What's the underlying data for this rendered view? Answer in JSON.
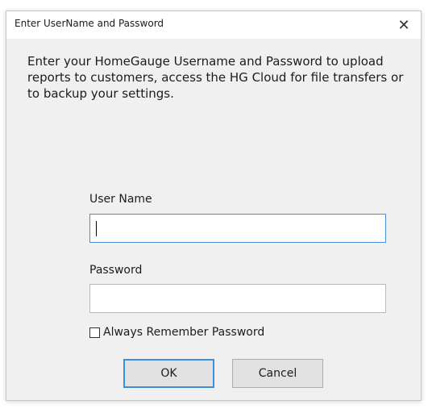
{
  "dialog": {
    "title": "Enter UserName and Password",
    "close_glyph": "✕",
    "close_icon": "close-icon",
    "intro": "Enter your HomeGauge Username and Password to upload reports to customers, access the HG Cloud for file transfers or to backup your settings."
  },
  "form": {
    "username_label": "User Name",
    "username_value": "",
    "password_label": "Password",
    "password_value": "",
    "remember_label": "Always Remember Password",
    "remember_checked": false
  },
  "buttons": {
    "ok_label": "OK",
    "cancel_label": "Cancel"
  },
  "colors": {
    "focus_border": "#4a90d9",
    "default_button_border": "#3c8fdc",
    "dialog_background": "#f0f0f0"
  }
}
